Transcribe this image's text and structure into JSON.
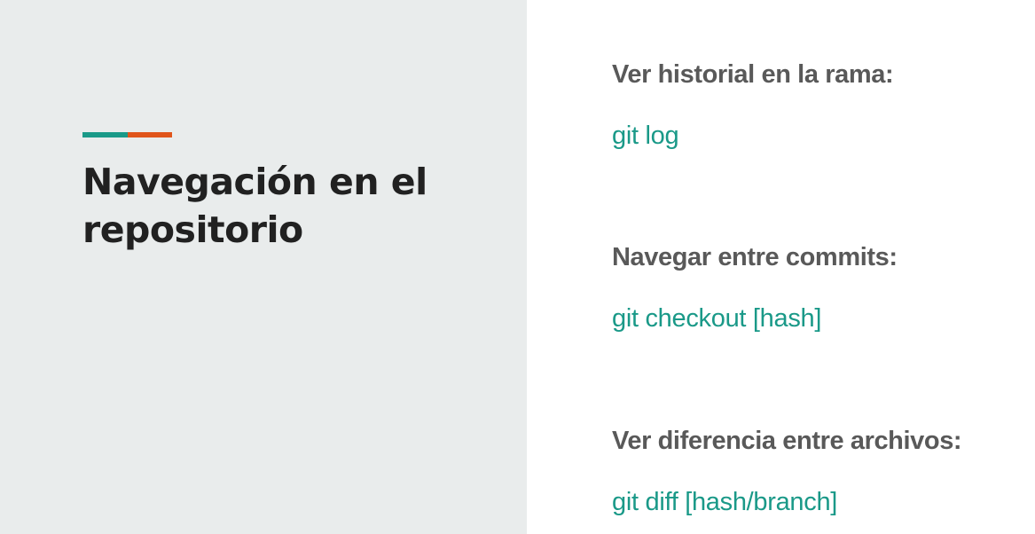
{
  "slide": {
    "title": "Navegación en el repositorio",
    "accent_colors": [
      "#1a9988",
      "#e0551b"
    ],
    "background_left": "#e9ecec",
    "command_color": "#1a9988"
  },
  "items": [
    {
      "heading": "Ver historial en la rama:",
      "command": "git log"
    },
    {
      "heading": "Navegar entre commits:",
      "command": "git checkout [hash]"
    },
    {
      "heading": "Ver diferencia entre archivos:",
      "command": "git diff [hash/branch]"
    }
  ]
}
